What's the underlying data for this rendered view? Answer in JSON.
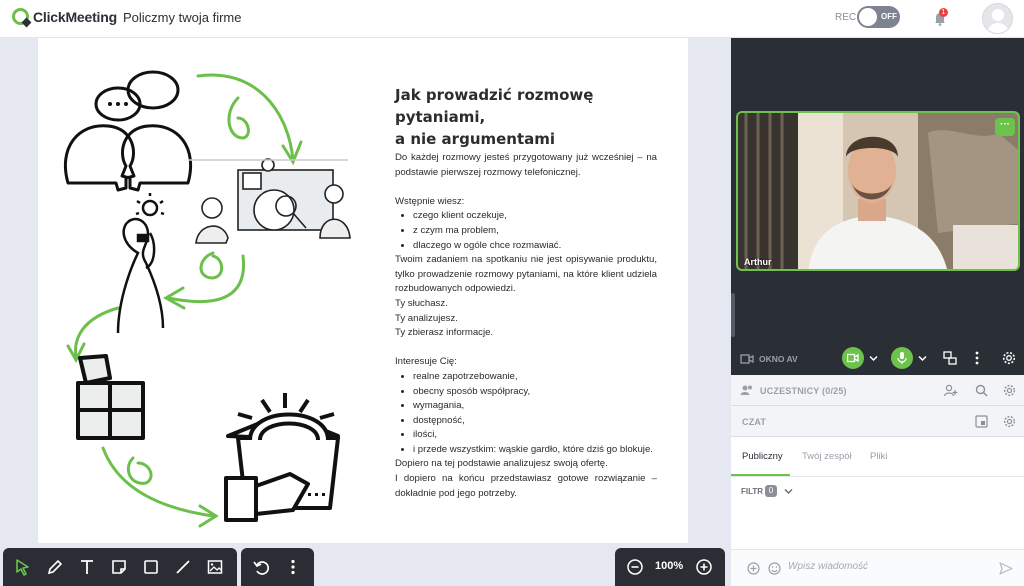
{
  "app": {
    "brand": "ClickMeeting",
    "meeting_title": "Policzmy twoja firme"
  },
  "header": {
    "rec_label": "REC",
    "rec_state": "OFF",
    "notification_count": "1"
  },
  "slide": {
    "title_line1": "Jak prowadzić rozmowę pytaniami,",
    "title_line2": "a nie argumentami",
    "intro": "Do każdej rozmowy jesteś przygotowany już wcześniej – na podstawie pierwszej rozmowy telefonicznej.",
    "know_heading": "Wstępnie wiesz:",
    "know_items": [
      "czego klient oczekuje,",
      "z czym ma problem,",
      "dlaczego w ogóle chce rozmawiać."
    ],
    "task": "Twoim zadaniem na spotkaniu nie jest opisywanie produktu, tylko prowadzenie rozmowy pytaniami, na które klient udziela rozbudowanych odpowiedzi.",
    "lines": [
      "Ty słuchasz.",
      "Ty analizujesz.",
      "Ty zbierasz informacje."
    ],
    "interest_heading": "Interesuje Cię:",
    "interest_items": [
      "realne zapotrzebowanie,",
      "obecny sposób współpracy,",
      "wymagania,",
      "dostępność,",
      "ilości,",
      "i przede wszystkim: wąskie gardło, które dziś go blokuje."
    ],
    "closing1": "Dopiero na tej podstawie analizujesz swoją ofertę.",
    "closing2": "I dopiero na końcu przedstawiasz gotowe rozwiązanie – dokładnie pod jego potrzeby."
  },
  "zoom": {
    "level": "100%"
  },
  "video": {
    "participant_name": "Arthur"
  },
  "av": {
    "label": "OKNO AV"
  },
  "participants": {
    "label": "UCZESTNICY (0/25)"
  },
  "chat": {
    "label": "CZAT",
    "tabs": [
      "Publiczny",
      "Twój zespół",
      "Pliki"
    ],
    "filter_label": "FILTR",
    "filter_count": "0",
    "input_placeholder": "Wpisz wiadomość"
  },
  "colors": {
    "accent": "#6cc24a",
    "panel": "#2a2e35",
    "toolbar": "#2a2d33"
  },
  "icons": {
    "toolbar": [
      "pointer-icon",
      "pen-icon",
      "text-icon",
      "note-icon",
      "rectangle-icon",
      "line-icon",
      "image-icon"
    ],
    "misc": [
      "undo-icon",
      "more-icon",
      "zoom-out-icon",
      "zoom-in-icon"
    ]
  }
}
